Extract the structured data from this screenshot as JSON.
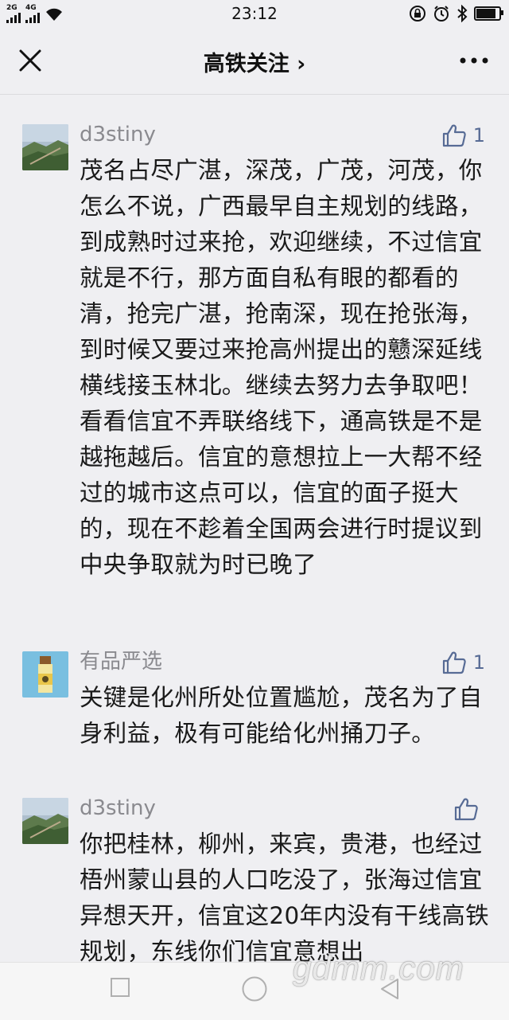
{
  "status_bar": {
    "time": "23:12",
    "network_labels": [
      "2G",
      "4G"
    ]
  },
  "nav": {
    "title": "高铁关注 ›"
  },
  "comments": [
    {
      "username": "d3stiny",
      "like_count": "1",
      "text": "茂名占尽广湛，深茂，广茂，河茂，你怎么不说，广西最早自主规划的线路，到成熟时过来抢，欢迎继续，不过信宜就是不行，那方面自私有眼的都看的清，抢完广湛，抢南深，现在抢张海，到时候又要过来抢高州提出的戆深延线横线接玉林北。继续去努力去争取吧！看看信宜不弄联络线下，通高铁是不是越拖越后。信宜的意想拉上一大帮不经过的城市这点可以，信宜的面子挺大的，现在不趁着全国两会进行时提议到中央争取就为时已晚了"
    },
    {
      "username": "有品严选",
      "like_count": "1",
      "text": "关键是化州所处位置尴尬，茂名为了自身利益，极有可能给化州捅刀子。"
    },
    {
      "username": "d3stiny",
      "like_count": "",
      "text": "你把桂林，柳州，来宾，贵港，也经过梧州蒙山县的人口吃没了，张海过信宜异想天开，信宜这20年内没有干线高铁规划，东线你们信宜意想出"
    }
  ],
  "watermark": "gdmm.com",
  "colors": {
    "background": "#efeff2",
    "like_blue": "#576b95",
    "username_gray": "#8a8a8f"
  },
  "icons": [
    "close-icon",
    "more-icon",
    "thumbs-up-icon",
    "square-icon",
    "circle-icon",
    "back-triangle-icon",
    "wifi-icon",
    "battery-icon",
    "bluetooth-icon",
    "alarm-icon",
    "lock-rotation-icon"
  ]
}
